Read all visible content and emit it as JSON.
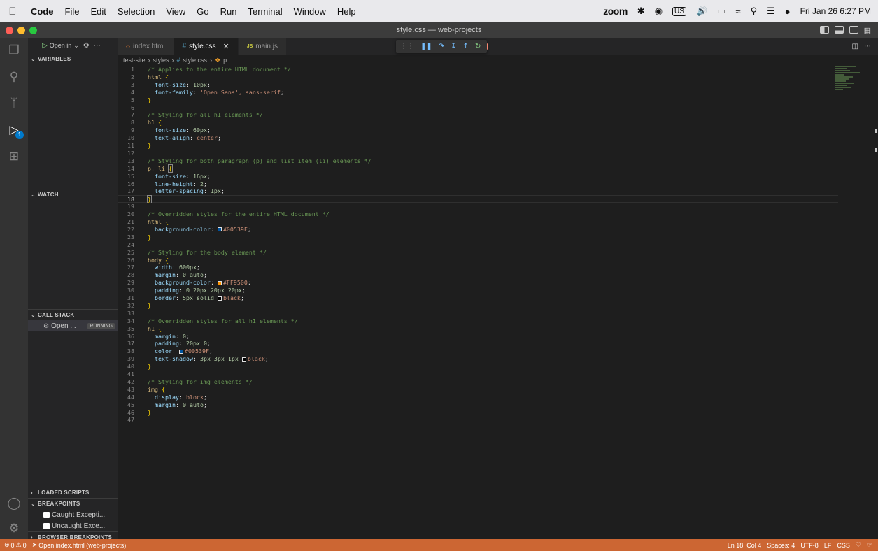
{
  "menubar": {
    "app_name": "Code",
    "items": [
      "File",
      "Edit",
      "Selection",
      "View",
      "Go",
      "Run",
      "Terminal",
      "Window",
      "Help"
    ],
    "zoom_label": "zoom",
    "input_source": "US",
    "clock": "Fri Jan 26  6:27 PM"
  },
  "window": {
    "title": "style.css — web-projects"
  },
  "activity_bar": {
    "run_debug_badge": "1"
  },
  "debug_toolbar": {
    "open_label": "Open in"
  },
  "sidebar": {
    "variables": "VARIABLES",
    "watch": "WATCH",
    "call_stack": "CALL STACK",
    "call_stack_item": "Open ...",
    "call_stack_state": "RUNNING",
    "loaded_scripts": "LOADED SCRIPTS",
    "breakpoints": "BREAKPOINTS",
    "bp_items": [
      "Caught Excepti...",
      "Uncaught Exce..."
    ],
    "browser_breakpoints": "BROWSER BREAKPOINTS"
  },
  "tabs": [
    {
      "label": "index.html",
      "active": false
    },
    {
      "label": "style.css",
      "active": true
    },
    {
      "label": "main.js",
      "active": false
    }
  ],
  "breadcrumb": [
    "test-site",
    "styles",
    "style.css",
    "p"
  ],
  "editor": {
    "current_line": 18,
    "lines": [
      "1",
      "2",
      "3",
      "4",
      "5",
      "6",
      "7",
      "8",
      "9",
      "10",
      "11",
      "12",
      "13",
      "14",
      "15",
      "16",
      "17",
      "18",
      "19",
      "20",
      "21",
      "22",
      "23",
      "24",
      "25",
      "26",
      "27",
      "28",
      "29",
      "30",
      "31",
      "32",
      "33",
      "34",
      "35",
      "36",
      "37",
      "38",
      "39",
      "40",
      "41",
      "42",
      "43",
      "44",
      "45",
      "46",
      "47"
    ],
    "code": {
      "l1": "/* Applies to the entire HTML document */",
      "l2_sel": "html",
      "l3_prop": "font-size",
      "l3_val": "10px",
      "l4_prop": "font-family",
      "l4_val": "'Open Sans', sans-serif",
      "l7": "/* Styling for all h1 elements */",
      "l8_sel": "h1",
      "l9_prop": "font-size",
      "l9_val": "60px",
      "l10_prop": "text-align",
      "l10_val": "center",
      "l13": "/* Styling for both paragraph (p) and list item (li) elements */",
      "l14_sel": "p, li",
      "l15_prop": "font-size",
      "l15_val": "16px",
      "l16_prop": "line-height",
      "l16_val": "2",
      "l17_prop": "letter-spacing",
      "l17_val": "1px",
      "l20": "/* Overridden styles for the entire HTML document */",
      "l21_sel": "html",
      "l22_prop": "background-color",
      "l22_val": "#00539F",
      "l25": "/* Styling for the body element */",
      "l26_sel": "body",
      "l27_prop": "width",
      "l27_val": "600px",
      "l28_prop": "margin",
      "l28_val": "0 auto",
      "l29_prop": "background-color",
      "l29_val": "#FF9500",
      "l30_prop": "padding",
      "l30_val": "0 20px 20px 20px",
      "l31_prop": "border",
      "l31_val_a": "5px solid",
      "l31_val_b": "black",
      "l34": "/* Overridden styles for all h1 elements */",
      "l35_sel": "h1",
      "l36_prop": "margin",
      "l36_val": "0",
      "l37_prop": "padding",
      "l37_val": "20px 0",
      "l38_prop": "color",
      "l38_val": "#00539F",
      "l39_prop": "text-shadow",
      "l39_val_a": "3px 3px 1px",
      "l39_val_b": "black",
      "l42": "/* Styling for img elements */",
      "l43_sel": "img",
      "l44_prop": "display",
      "l44_val": "block",
      "l45_prop": "margin",
      "l45_val": "0 auto"
    }
  },
  "colors": {
    "statusbar": "#cc6633",
    "swatch_blue": "#00539F",
    "swatch_orange": "#FF9500",
    "swatch_black": "#000000"
  },
  "statusbar": {
    "errors": "0",
    "warnings": "0",
    "launch": "Open index.html (web-projects)",
    "position": "Ln 18, Col 4",
    "spaces": "Spaces: 4",
    "encoding": "UTF-8",
    "eol": "LF",
    "language": "CSS"
  }
}
